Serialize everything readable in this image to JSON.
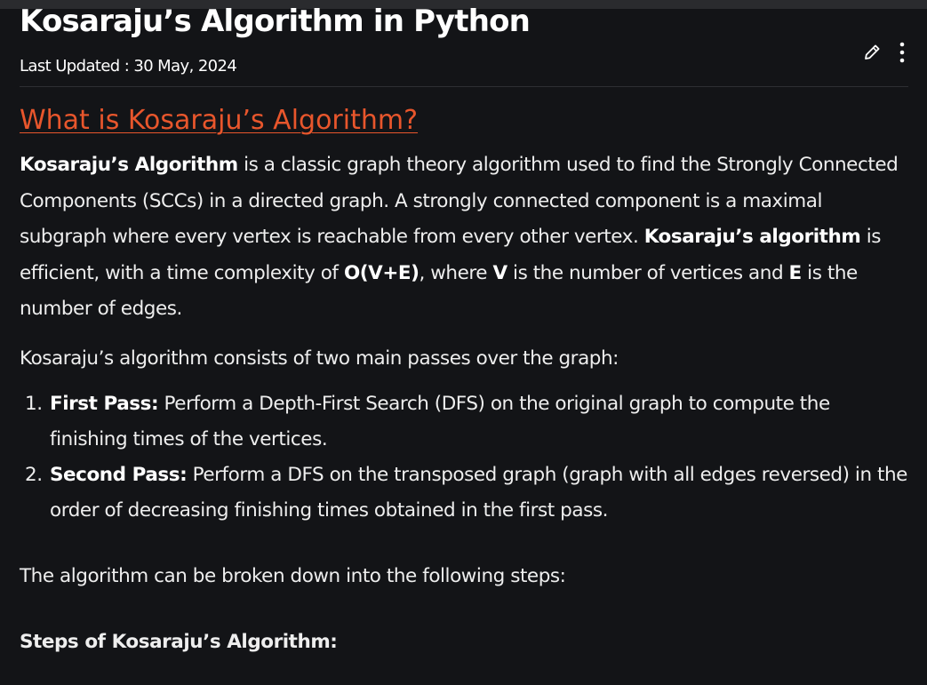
{
  "article": {
    "title": "Kosaraju’s Algorithm in Python",
    "last_updated": "Last Updated : 30 May, 2024",
    "section_title": "What is Kosaraju’s Algorithm?",
    "intro": {
      "b1": "Kosaraju’s Algorithm",
      "t1": " is a classic graph theory algorithm used to find the Strongly Connected Components (SCCs) in a directed graph. A strongly connected component is a maximal subgraph where every vertex is reachable from every other vertex. ",
      "b2": "Kosaraju’s algorithm",
      "t2": " is efficient, with a time complexity of ",
      "b3": "O(V+E)",
      "t3": ", where ",
      "b4": "V",
      "t4": " is the number of vertices and ",
      "b5": "E",
      "t5": " is the number of edges."
    },
    "passes_intro": "Kosaraju’s algorithm consists of two main passes over the graph:",
    "passes": [
      {
        "number": "1.",
        "label": "First Pass:",
        "text": " Perform a Depth-First Search (DFS) on the original graph to compute the finishing times of the vertices."
      },
      {
        "number": "2.",
        "label": "Second Pass:",
        "text": " Perform a DFS on the transposed graph (graph with all edges reversed) in the order of decreasing finishing times obtained in the first pass."
      }
    ],
    "steps_intro": "The algorithm can be broken down into the following steps:",
    "steps_heading": "Steps of Kosaraju’s Algorithm:"
  },
  "toolbar": {
    "edit_icon": "pencil-icon",
    "more_icon": "vertical-dots-icon"
  },
  "colors": {
    "background": "#131417",
    "accent_link": "#e8562c",
    "text": "#eeeeee"
  }
}
